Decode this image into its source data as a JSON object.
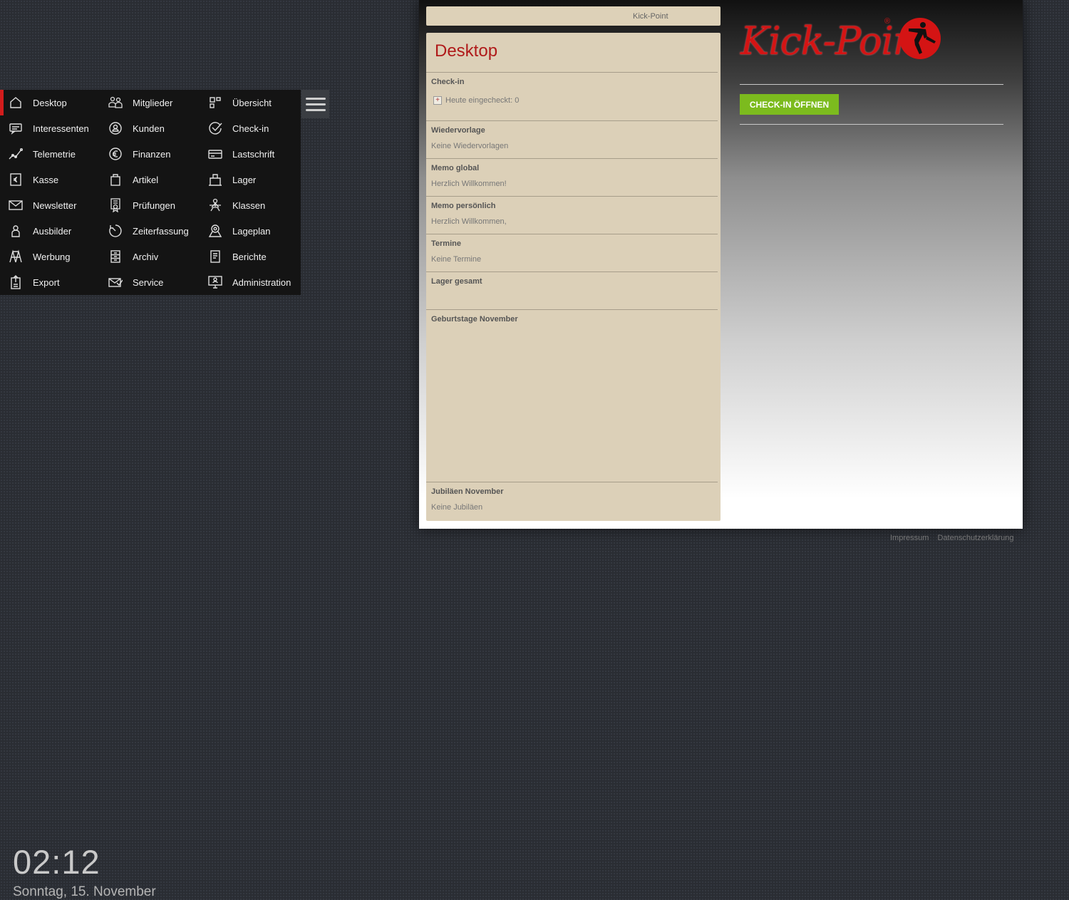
{
  "menu": {
    "items": [
      {
        "label": "Desktop",
        "icon": "home-icon",
        "active": true
      },
      {
        "label": "Mitglieder",
        "icon": "members-icon"
      },
      {
        "label": "Übersicht",
        "icon": "overview-icon"
      },
      {
        "label": "Interessenten",
        "icon": "chat-icon"
      },
      {
        "label": "Kunden",
        "icon": "customer-icon"
      },
      {
        "label": "Check-in",
        "icon": "check-icon"
      },
      {
        "label": "Telemetrie",
        "icon": "telemetry-icon"
      },
      {
        "label": "Finanzen",
        "icon": "euro-icon"
      },
      {
        "label": "Lastschrift",
        "icon": "card-icon"
      },
      {
        "label": "Kasse",
        "icon": "cash-register-icon"
      },
      {
        "label": "Artikel",
        "icon": "bag-icon"
      },
      {
        "label": "Lager",
        "icon": "storage-icon"
      },
      {
        "label": "Newsletter",
        "icon": "mail-icon"
      },
      {
        "label": "Prüfungen",
        "icon": "certificate-icon"
      },
      {
        "label": "Klassen",
        "icon": "class-icon"
      },
      {
        "label": "Ausbilder",
        "icon": "trainer-icon"
      },
      {
        "label": "Zeiterfassung",
        "icon": "timer-icon"
      },
      {
        "label": "Lageplan",
        "icon": "location-icon"
      },
      {
        "label": "Werbung",
        "icon": "ad-icon"
      },
      {
        "label": "Archiv",
        "icon": "archive-icon"
      },
      {
        "label": "Berichte",
        "icon": "report-icon"
      },
      {
        "label": "Export",
        "icon": "export-icon"
      },
      {
        "label": "Service",
        "icon": "service-icon"
      },
      {
        "label": "Administration",
        "icon": "admin-icon"
      }
    ]
  },
  "window": {
    "title": "Kick-Point",
    "panel_title": "Desktop",
    "sections": {
      "checkin": {
        "title": "Check-in",
        "text": "Heute eingecheckt: 0"
      },
      "wiedervorlage": {
        "title": "Wiedervorlage",
        "text": "Keine Wiedervorlagen"
      },
      "memo_global": {
        "title": "Memo global",
        "text": "Herzlich Willkommen!"
      },
      "memo_personal": {
        "title": "Memo persönlich",
        "text": "Herzlich Willkommen,"
      },
      "termine": {
        "title": "Termine",
        "text": "Keine Termine"
      },
      "lager": {
        "title": "Lager gesamt",
        "text": ""
      },
      "birthdays": {
        "title": "Geburtstage November",
        "text": ""
      },
      "jubilees": {
        "title": "Jubiläen November",
        "text": "Keine Jubiläen"
      }
    },
    "logo_text": "Kick-Point",
    "logo_reg": "®",
    "checkin_button": "CHECK-IN ÖFFNEN"
  },
  "footer": {
    "impressum": "Impressum",
    "privacy": "Datenschutzerklärung"
  },
  "clock": {
    "time": "02:12",
    "date": "Sonntag, 15. November"
  },
  "colors": {
    "accent": "#b01a1a",
    "button": "#7cbb1e",
    "panel": "#dcd0b8",
    "menu_bg": "#141414"
  }
}
